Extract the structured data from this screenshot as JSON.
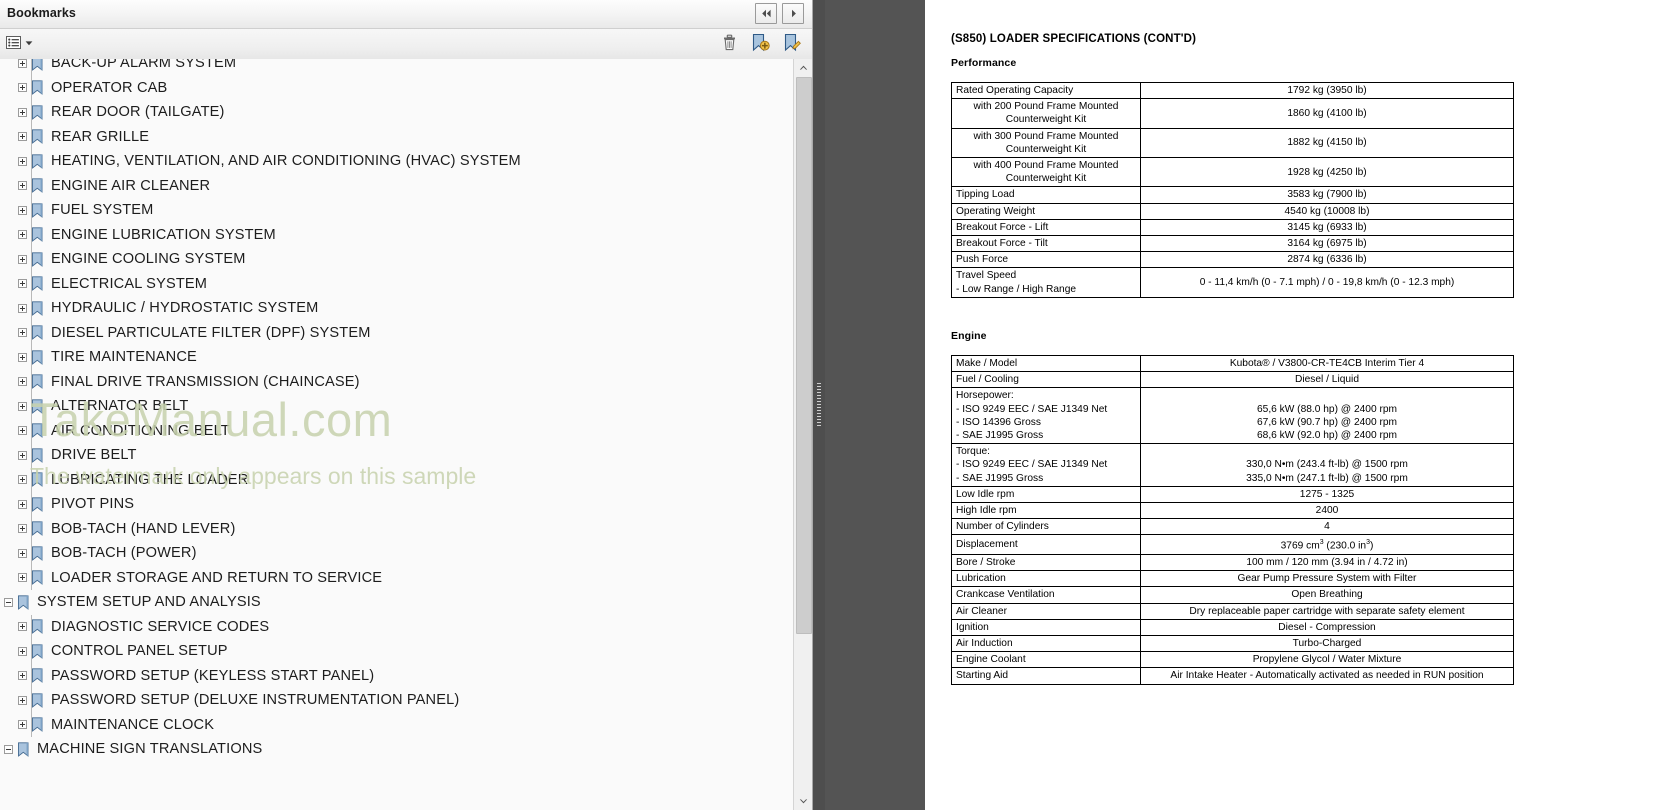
{
  "bookmarks_panel": {
    "title": "Bookmarks",
    "nav_prev_icon": "double-chevron-left-icon",
    "nav_next_icon": "chevron-right-icon",
    "toolbar": {
      "options_icon": "list-options-icon",
      "options_caret_icon": "caret-down-icon",
      "delete_icon": "trash-icon",
      "new_bookmark_icon": "new-bookmark-icon",
      "edit_bookmark_icon": "edit-bookmark-icon"
    },
    "items": [
      {
        "label": "BACK-UP ALARM SYSTEM",
        "level": 1,
        "state": "collapsed"
      },
      {
        "label": "OPERATOR CAB",
        "level": 1,
        "state": "collapsed"
      },
      {
        "label": "REAR DOOR (TAILGATE)",
        "level": 1,
        "state": "collapsed"
      },
      {
        "label": "REAR GRILLE",
        "level": 1,
        "state": "collapsed"
      },
      {
        "label": "HEATING, VENTILATION, AND AIR CONDITIONING (HVAC) SYSTEM",
        "level": 1,
        "state": "collapsed"
      },
      {
        "label": "ENGINE AIR CLEANER",
        "level": 1,
        "state": "collapsed"
      },
      {
        "label": "FUEL SYSTEM",
        "level": 1,
        "state": "collapsed"
      },
      {
        "label": "ENGINE LUBRICATION SYSTEM",
        "level": 1,
        "state": "collapsed"
      },
      {
        "label": "ENGINE COOLING SYSTEM",
        "level": 1,
        "state": "collapsed"
      },
      {
        "label": "ELECTRICAL SYSTEM",
        "level": 1,
        "state": "collapsed"
      },
      {
        "label": "HYDRAULIC / HYDROSTATIC SYSTEM",
        "level": 1,
        "state": "collapsed"
      },
      {
        "label": "DIESEL PARTICULATE FILTER (DPF) SYSTEM",
        "level": 1,
        "state": "collapsed"
      },
      {
        "label": "TIRE MAINTENANCE",
        "level": 1,
        "state": "collapsed"
      },
      {
        "label": "FINAL DRIVE TRANSMISSION (CHAINCASE)",
        "level": 1,
        "state": "collapsed"
      },
      {
        "label": "ALTERNATOR BELT",
        "level": 1,
        "state": "collapsed"
      },
      {
        "label": "AIR CONDITIONING BELT",
        "level": 1,
        "state": "collapsed"
      },
      {
        "label": "DRIVE BELT",
        "level": 1,
        "state": "collapsed"
      },
      {
        "label": "LUBRICATING THE LOADER",
        "level": 1,
        "state": "collapsed"
      },
      {
        "label": "PIVOT PINS",
        "level": 1,
        "state": "collapsed"
      },
      {
        "label": "BOB-TACH (HAND LEVER)",
        "level": 1,
        "state": "collapsed"
      },
      {
        "label": "BOB-TACH (POWER)",
        "level": 1,
        "state": "collapsed"
      },
      {
        "label": "LOADER STORAGE AND RETURN TO SERVICE",
        "level": 1,
        "state": "collapsed"
      },
      {
        "label": "SYSTEM SETUP AND ANALYSIS",
        "level": 0,
        "state": "expanded"
      },
      {
        "label": "DIAGNOSTIC SERVICE CODES",
        "level": 1,
        "state": "collapsed"
      },
      {
        "label": "CONTROL PANEL SETUP",
        "level": 1,
        "state": "collapsed"
      },
      {
        "label": "PASSWORD SETUP (KEYLESS START PANEL)",
        "level": 1,
        "state": "collapsed"
      },
      {
        "label": "PASSWORD SETUP (DELUXE INSTRUMENTATION PANEL)",
        "level": 1,
        "state": "collapsed"
      },
      {
        "label": "MAINTENANCE CLOCK",
        "level": 1,
        "state": "collapsed"
      },
      {
        "label": "MACHINE SIGN TRANSLATIONS",
        "level": 0,
        "state": "expanded"
      }
    ],
    "watermark_line1": "TakeManual.com",
    "watermark_line2": "The watermark only appears on this sample",
    "watermark_color": "#c7d2ad"
  },
  "document": {
    "title": "(S850) LOADER SPECIFICATIONS (CONT'D)",
    "sections": [
      {
        "heading": "Performance",
        "rows": [
          {
            "key": "Rated Operating Capacity",
            "value": "1792 kg (3950 lb)",
            "key_indent": false
          },
          {
            "key": "with 200 Pound Frame Mounted\nCounterweight Kit",
            "value": "1860 kg (4100 lb)",
            "key_indent": true
          },
          {
            "key": "with 300 Pound Frame Mounted\nCounterweight Kit",
            "value": "1882 kg (4150 lb)",
            "key_indent": true
          },
          {
            "key": "with 400 Pound Frame Mounted\nCounterweight Kit",
            "value": "1928 kg (4250 lb)",
            "key_indent": true
          },
          {
            "key": "Tipping Load",
            "value": "3583 kg (7900 lb)",
            "key_indent": false
          },
          {
            "key": "Operating Weight",
            "value": "4540 kg (10008 lb)",
            "key_indent": false
          },
          {
            "key": "Breakout Force - Lift",
            "value": "3145 kg (6933 lb)",
            "key_indent": false
          },
          {
            "key": "Breakout Force - Tilt",
            "value": "3164 kg (6975 lb)",
            "key_indent": false
          },
          {
            "key": "Push Force",
            "value": "2874 kg (6336 lb)",
            "key_indent": false
          },
          {
            "key": "Travel Speed\n - Low Range / High Range",
            "value": "0 - 11,4 km/h (0 - 7.1 mph) / 0 - 19,8 km/h (0 - 12.3 mph)",
            "key_indent": false
          }
        ]
      },
      {
        "heading": "Engine",
        "rows": [
          {
            "key": "Make / Model",
            "value": "Kubota® / V3800-CR-TE4CB Interim Tier 4",
            "key_indent": false
          },
          {
            "key": "Fuel / Cooling",
            "value": "Diesel / Liquid",
            "key_indent": false
          },
          {
            "key": "Horsepower:\n - ISO 9249 EEC / SAE J1349 Net\n - ISO 14396 Gross\n - SAE J1995 Gross",
            "value": "\n65,6 kW (88.0 hp) @ 2400 rpm\n67,6 kW (90.7 hp) @ 2400 rpm\n68,6 kW (92.0 hp) @ 2400 rpm",
            "key_indent": false
          },
          {
            "key": "Torque:\n - ISO 9249 EEC / SAE J1349 Net\n - SAE J1995 Gross",
            "value": "\n330,0 N•m (243.4 ft-lb) @ 1500 rpm\n335,0 N•m (247.1 ft-lb) @ 1500 rpm",
            "key_indent": false
          },
          {
            "key": "Low Idle rpm",
            "value": "1275 - 1325",
            "key_indent": false
          },
          {
            "key": "High Idle rpm",
            "value": "2400",
            "key_indent": false
          },
          {
            "key": "Number of Cylinders",
            "value": "4",
            "key_indent": false
          },
          {
            "key": "Displacement",
            "value": "3769 cm3 (230.0 in3)",
            "key_indent": false,
            "superscripts": true
          },
          {
            "key": "Bore / Stroke",
            "value": "100 mm / 120 mm (3.94 in / 4.72 in)",
            "key_indent": false
          },
          {
            "key": "Lubrication",
            "value": "Gear Pump Pressure System with Filter",
            "key_indent": false
          },
          {
            "key": "Crankcase Ventilation",
            "value": "Open Breathing",
            "key_indent": false
          },
          {
            "key": "Air Cleaner",
            "value": "Dry replaceable paper cartridge with separate safety element",
            "key_indent": false
          },
          {
            "key": "Ignition",
            "value": "Diesel - Compression",
            "key_indent": false
          },
          {
            "key": "Air Induction",
            "value": "Turbo-Charged",
            "key_indent": false
          },
          {
            "key": "Engine Coolant",
            "value": "Propylene Glycol / Water Mixture",
            "key_indent": false
          },
          {
            "key": "Starting Aid",
            "value": "Air Intake Heater - Automatically activated as needed in RUN position",
            "key_indent": false
          }
        ]
      }
    ]
  },
  "colors": {
    "doc_background": "#545454",
    "panel_background": "#f1f1f1",
    "tree_background": "#fafafa",
    "page_white": "#ffffff"
  }
}
